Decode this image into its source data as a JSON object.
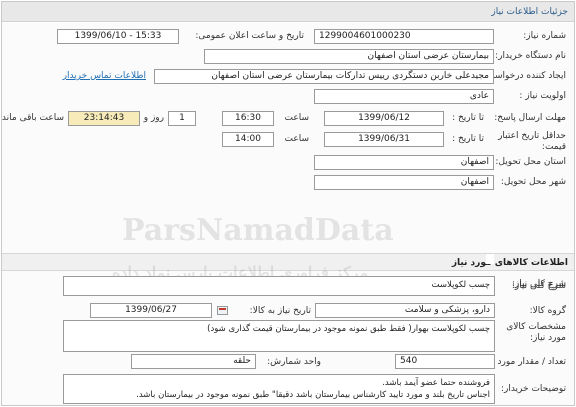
{
  "title": "جزئیات اطلاعات نیاز",
  "info": {
    "need_number_label": "شماره نیاز:",
    "need_number": "1299004601000230",
    "announce_label": "تاریخ و ساعت اعلان عمومی:",
    "announce_value": "1399/06/10 - 15:33",
    "buyer_label": "نام دستگاه خریدار:",
    "buyer": "بیمارستان عرضی استان اصفهان",
    "creator_label": "ایجاد کننده درخواست:",
    "creator": "مجیدعلی خاربن دستگردی رییس تدارکات بیمارستان عرضی استان اصفهان",
    "contact_link": "اطلاعات تماس خریدار",
    "priority_label": "اولویت نیاز :",
    "priority": "عادی",
    "send_deadline_label": "مهلت ارسال پاسخ:",
    "until_date_label": "تا تاریخ :",
    "send_date": "1399/06/12",
    "time_label": "ساعت",
    "send_time": "16:30",
    "days": "1",
    "days_label": "روز و",
    "remaining": "23:14:43",
    "remaining_label": "ساعت باقی مانده",
    "validity_label": "حداقل تاریخ اعتبار قیمت:",
    "validity_until_label": "تا تاریخ :",
    "validity_date": "1399/06/31",
    "validity_time_label": "ساعت",
    "validity_time": "14:00",
    "delivery_province_label": "استان محل تحویل:",
    "delivery_province": "اصفهان",
    "delivery_city_label": "شهر محل تحویل:",
    "delivery_city": "اصفهان"
  },
  "goods": {
    "header": "اطلاعات کالاهای مورد نیاز",
    "summary_label": "شرح کلی نیاز:",
    "summary": "چسب لکوپلاست",
    "group_label": "گروه کالا:",
    "group": "دارو، پزشکی و سلامت",
    "need_date_label": "تاریخ نیاز به کالا:",
    "need_date": "1399/06/27",
    "specs_label": "مشخصات کالای مورد نیاز:",
    "specs": "چسب لکوپلاست بهوار( فقط طبق نمونه موجود در بیمارستان قیمت گذاری شود)",
    "quantity_label": "تعداد / مقدار مورد نیاز:",
    "quantity": "540",
    "unit_label": "واحد شمارش:",
    "unit": "حلقه",
    "notes_label": "توضیحات خریدار:",
    "notes_line1": "فروشنده حتما عضو آیمد باشد.",
    "notes_line2": "اجناس تاریخ بلند و مورد تایید کارشناس بیمارستان باشد دقیقا\" طبق نمونه موجود در بیمارستان باشد."
  },
  "watermark": {
    "text1": "ParsNamadData",
    "text2": "مرکز فراوری اطلاعات پارس نماد داده"
  }
}
